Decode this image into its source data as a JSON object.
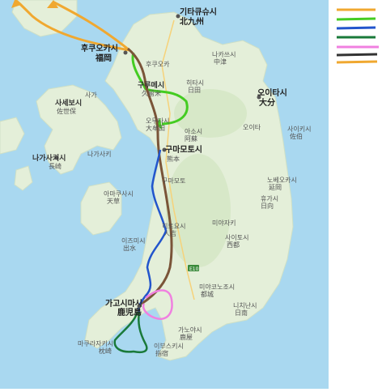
{
  "labels": {
    "kitakyushu_ko": "기타큐슈시",
    "kitakyushu_ja": "北九州",
    "kitakyushu_sub": "기타큐슈",
    "fukuoka_ko": "후쿠오카시",
    "fukuoka_ja": "福岡",
    "fukuoka_pref": "후쿠오카",
    "kurume_ko": "구루메시",
    "kurume_ja": "久留米",
    "oita_ko": "오이타시",
    "oita_ja": "大分",
    "oita_pref": "오이타",
    "sasebo_ko": "사세보시",
    "sasebo_ja": "佐世保",
    "saga": "사가",
    "nagasaki_ko": "나가사키시",
    "nagasaki_ja": "長崎",
    "nagasaki_pref": "나가사키",
    "omuta": "오무타시",
    "omuta_ja": "大牟田",
    "aso": "아소시",
    "aso_ja": "阿蘇",
    "kumamoto_ko": "구마모토시",
    "kumamoto_ja": "熊本",
    "kumamoto_pref": "구마모토",
    "amakusa": "아마쿠사시",
    "amakusa_ja": "天草",
    "saiki": "사이키시",
    "saiki_ja": "佐伯",
    "nobeoka": "노베오카시",
    "nobeoka_ja": "延岡",
    "hyuga": "휴가시",
    "hyuga_ja": "日向",
    "miyazaki_pref": "미야자키",
    "hitoyoshi": "히토요시",
    "hitoyoshi_ja": "人吉",
    "izumi": "이즈미시",
    "izumi_ja": "出水",
    "saito": "사이토시",
    "saito_ja": "西都",
    "miyakonojo": "미야코노조시",
    "miyakonojo_ja": "都城",
    "nichinan": "니치난시",
    "nichinan_ja": "日南",
    "kagoshima_ko": "가고시마시",
    "kagoshima_ja": "鹿児島",
    "kanoya": "가노야시",
    "kanoya_ja": "鹿屋",
    "makurazaki": "마쿠라자키시",
    "makurazaki_ja": "枕崎",
    "ibusuki": "이부스키시",
    "ibusuki_ja": "指宿",
    "nakatsu": "나카쓰시",
    "nakatsu_ja": "中津",
    "hita": "히타시",
    "hita_ja": "日田",
    "road": "E10"
  },
  "legend": {
    "colors": [
      "#f0a830",
      "#44cc22",
      "#2255cc",
      "#1a7a3a",
      "#f080e0",
      "#333333",
      "#f0a830"
    ]
  },
  "colors": {
    "sea": "#a9d8f0",
    "land": "#e4efd9",
    "orange": "#f0a830",
    "green": "#44cc22",
    "blue": "#2255cc",
    "darkgreen": "#1a7a3a",
    "pink": "#f080e0",
    "brown": "#7a5438"
  }
}
